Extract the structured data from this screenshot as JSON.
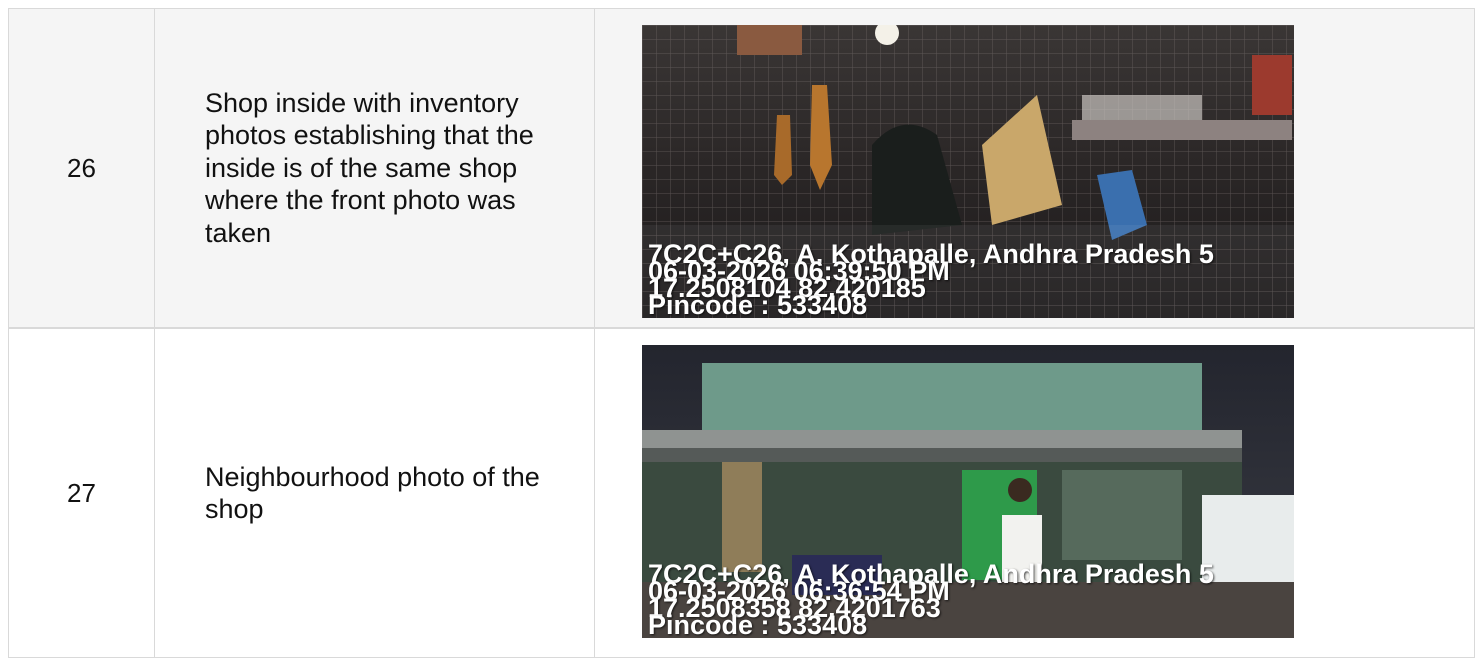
{
  "rows": [
    {
      "number": "26",
      "description": "Shop inside with inventory photos establishing that the inside is of the same shop where the front photo was taken",
      "photo": {
        "line1": "7C2C+C26, A. Kothapalle, Andhra Pradesh 5",
        "line2": "06-03-2026 06:39:50 PM",
        "line3": "17.2508104 82.420185",
        "line4": "Pincode : 533408"
      }
    },
    {
      "number": "27",
      "description": "Neighbourhood photo of the shop",
      "photo": {
        "line1": "7C2C+C26, A. Kothapalle, Andhra Pradesh 5",
        "line2": "06-03-2026 06:36:54 PM",
        "line3": "17.2508358 82.4201763",
        "line4": "Pincode : 533408"
      }
    }
  ]
}
